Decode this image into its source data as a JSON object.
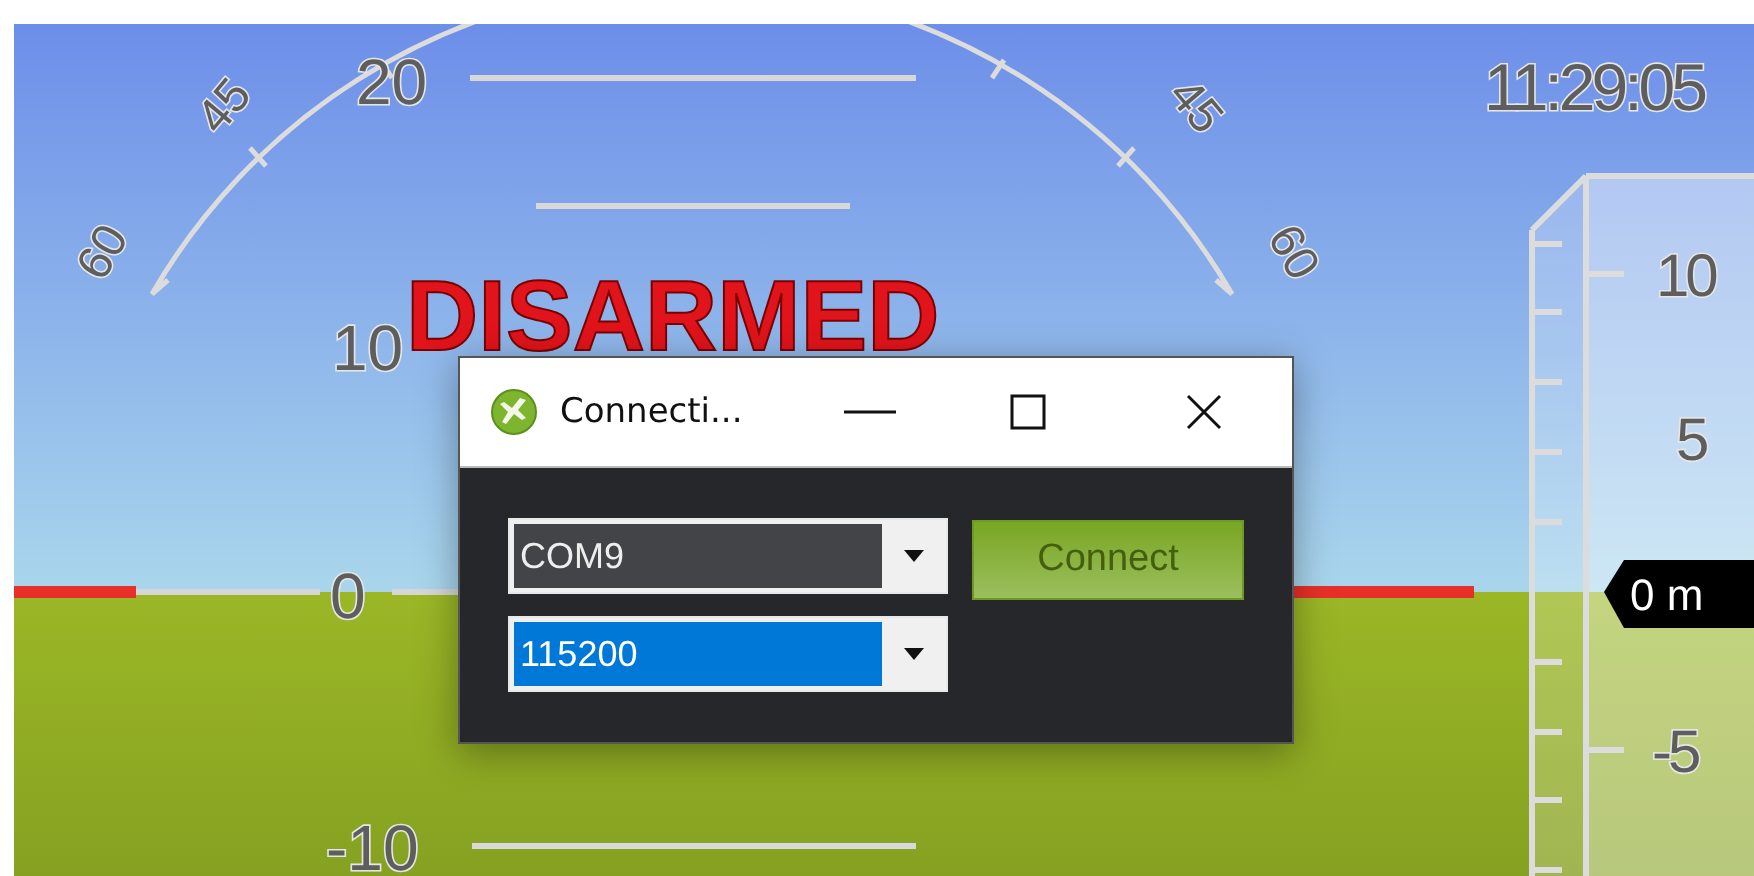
{
  "hud": {
    "pitch_labels": [
      "20",
      "10",
      "0",
      "-10"
    ],
    "roll_labels": [
      "45",
      "60",
      "45",
      "60"
    ],
    "status": "DISARMED",
    "time": "11:29:05",
    "altitude": {
      "scale": [
        "10",
        "5",
        "-5"
      ],
      "reading": "0 m"
    }
  },
  "dialog": {
    "title": "Connecti...",
    "fields": [
      {
        "value": "COM9",
        "selected": false
      },
      {
        "value": "115200",
        "selected": true
      }
    ],
    "connect_button": "Connect"
  }
}
